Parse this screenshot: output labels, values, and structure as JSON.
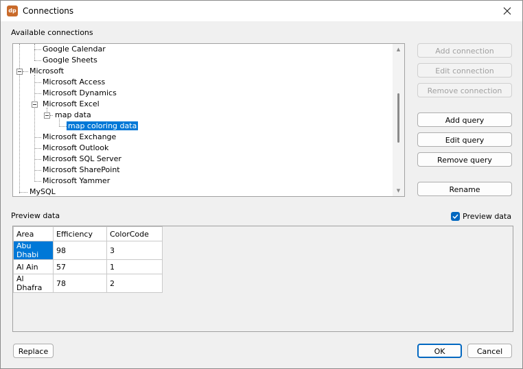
{
  "window": {
    "title": "Connections",
    "app_icon_text": "dp"
  },
  "labels": {
    "available_connections": "Available connections",
    "preview_data": "Preview data"
  },
  "tree": {
    "items": [
      {
        "label": "Google Calendar"
      },
      {
        "label": "Google Sheets"
      },
      {
        "label": "Microsoft"
      },
      {
        "label": "Microsoft Access"
      },
      {
        "label": "Microsoft Dynamics"
      },
      {
        "label": "Microsoft Excel"
      },
      {
        "label": "map data"
      },
      {
        "label": "map coloring data",
        "selected": true
      },
      {
        "label": "Microsoft Exchange"
      },
      {
        "label": "Microsoft Outlook"
      },
      {
        "label": "Microsoft SQL Server"
      },
      {
        "label": "Microsoft SharePoint"
      },
      {
        "label": "Microsoft Yammer"
      },
      {
        "label": "MySQL"
      }
    ]
  },
  "buttons": {
    "add_connection": "Add connection",
    "edit_connection": "Edit connection",
    "remove_connection": "Remove connection",
    "add_query": "Add query",
    "edit_query": "Edit query",
    "remove_query": "Remove query",
    "rename": "Rename",
    "replace": "Replace",
    "ok": "OK",
    "cancel": "Cancel"
  },
  "preview_checkbox": {
    "label": "Preview data",
    "checked": true
  },
  "preview_table": {
    "columns": [
      "Area",
      "Efficiency",
      "ColorCode"
    ],
    "rows": [
      [
        "Abu Dhabi",
        "98",
        "3"
      ],
      [
        "Al Ain",
        "57",
        "1"
      ],
      [
        "Al Dhafra",
        "78",
        "2"
      ]
    ]
  },
  "colors": {
    "selection": "#0078d7",
    "accent": "#0067c0"
  }
}
